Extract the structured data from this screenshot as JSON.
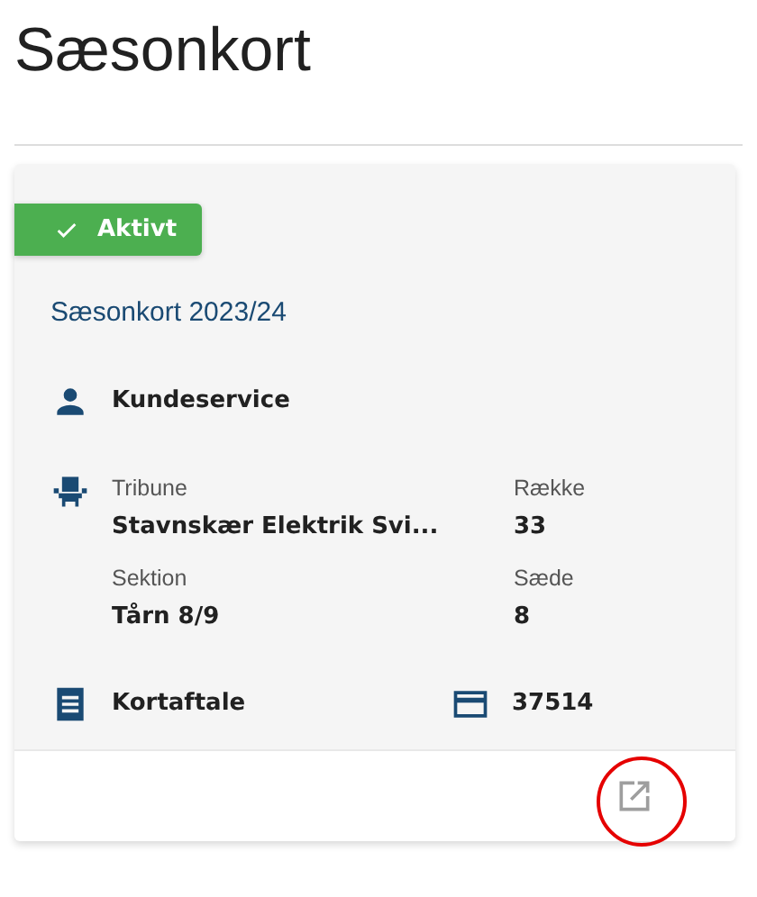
{
  "page_title": "Sæsonkort",
  "card": {
    "status": {
      "label": "Aktivt",
      "active": true
    },
    "title": "Sæsonkort 2023/24",
    "holder": "Kundeservice",
    "seat": [
      {
        "label": "Tribune",
        "value": "Stavnskær Elektrik Svi..."
      },
      {
        "label": "Række",
        "value": "33"
      },
      {
        "label": "Sektion",
        "value": "Tårn 8/9"
      },
      {
        "label": "Sæde",
        "value": "8"
      }
    ],
    "agreement": "Kortaftale",
    "card_number": "37514",
    "footer": {
      "open_link_highlighted": true
    }
  }
}
